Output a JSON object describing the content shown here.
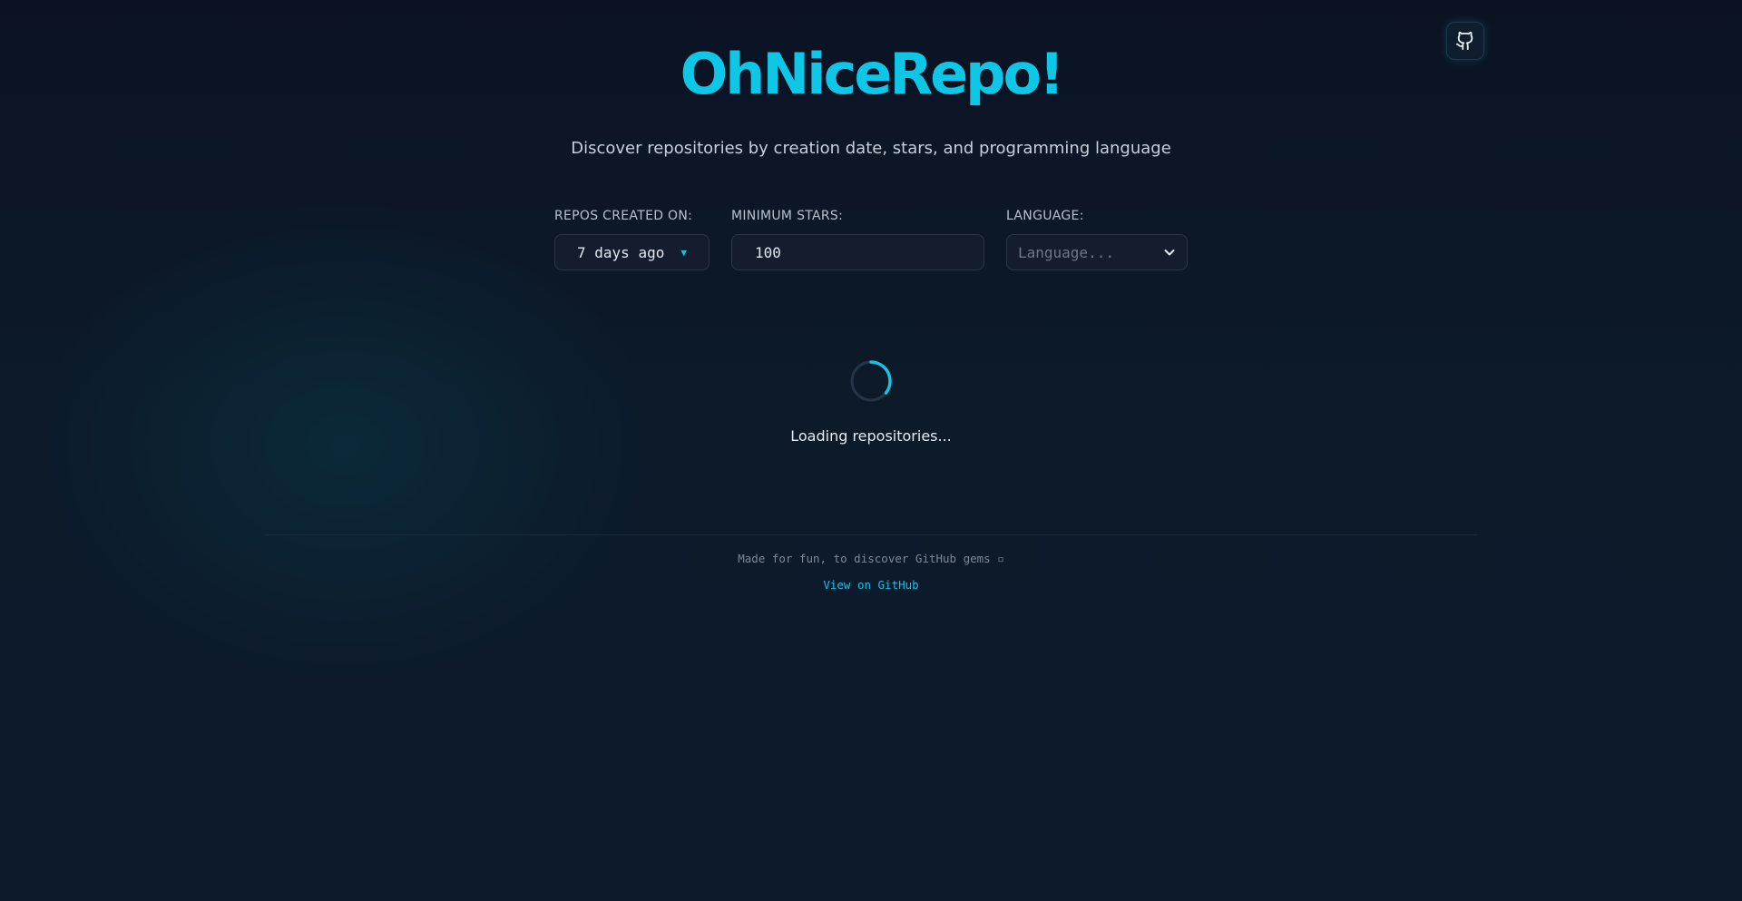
{
  "header": {
    "title": "OhNiceRepo!",
    "subtitle": "Discover repositories by creation date, stars, and programming language",
    "github_button_icon": "github-icon"
  },
  "filters": {
    "created_label": "REPOS CREATED ON:",
    "created_value": "7 days ago",
    "stars_label": "MINIMUM STARS:",
    "stars_value": "100",
    "language_label": "LANGUAGE:",
    "language_placeholder": "Language..."
  },
  "status": {
    "loading_text": "Loading repositories..."
  },
  "footer": {
    "tagline": "Made for fun, to discover GitHub gems ▫",
    "link_text": "View on GitHub"
  },
  "colors": {
    "accent": "#0ec6e6",
    "background": "#0c1a2a",
    "control_bg": "#131d2e",
    "control_border": "#2a3648"
  }
}
